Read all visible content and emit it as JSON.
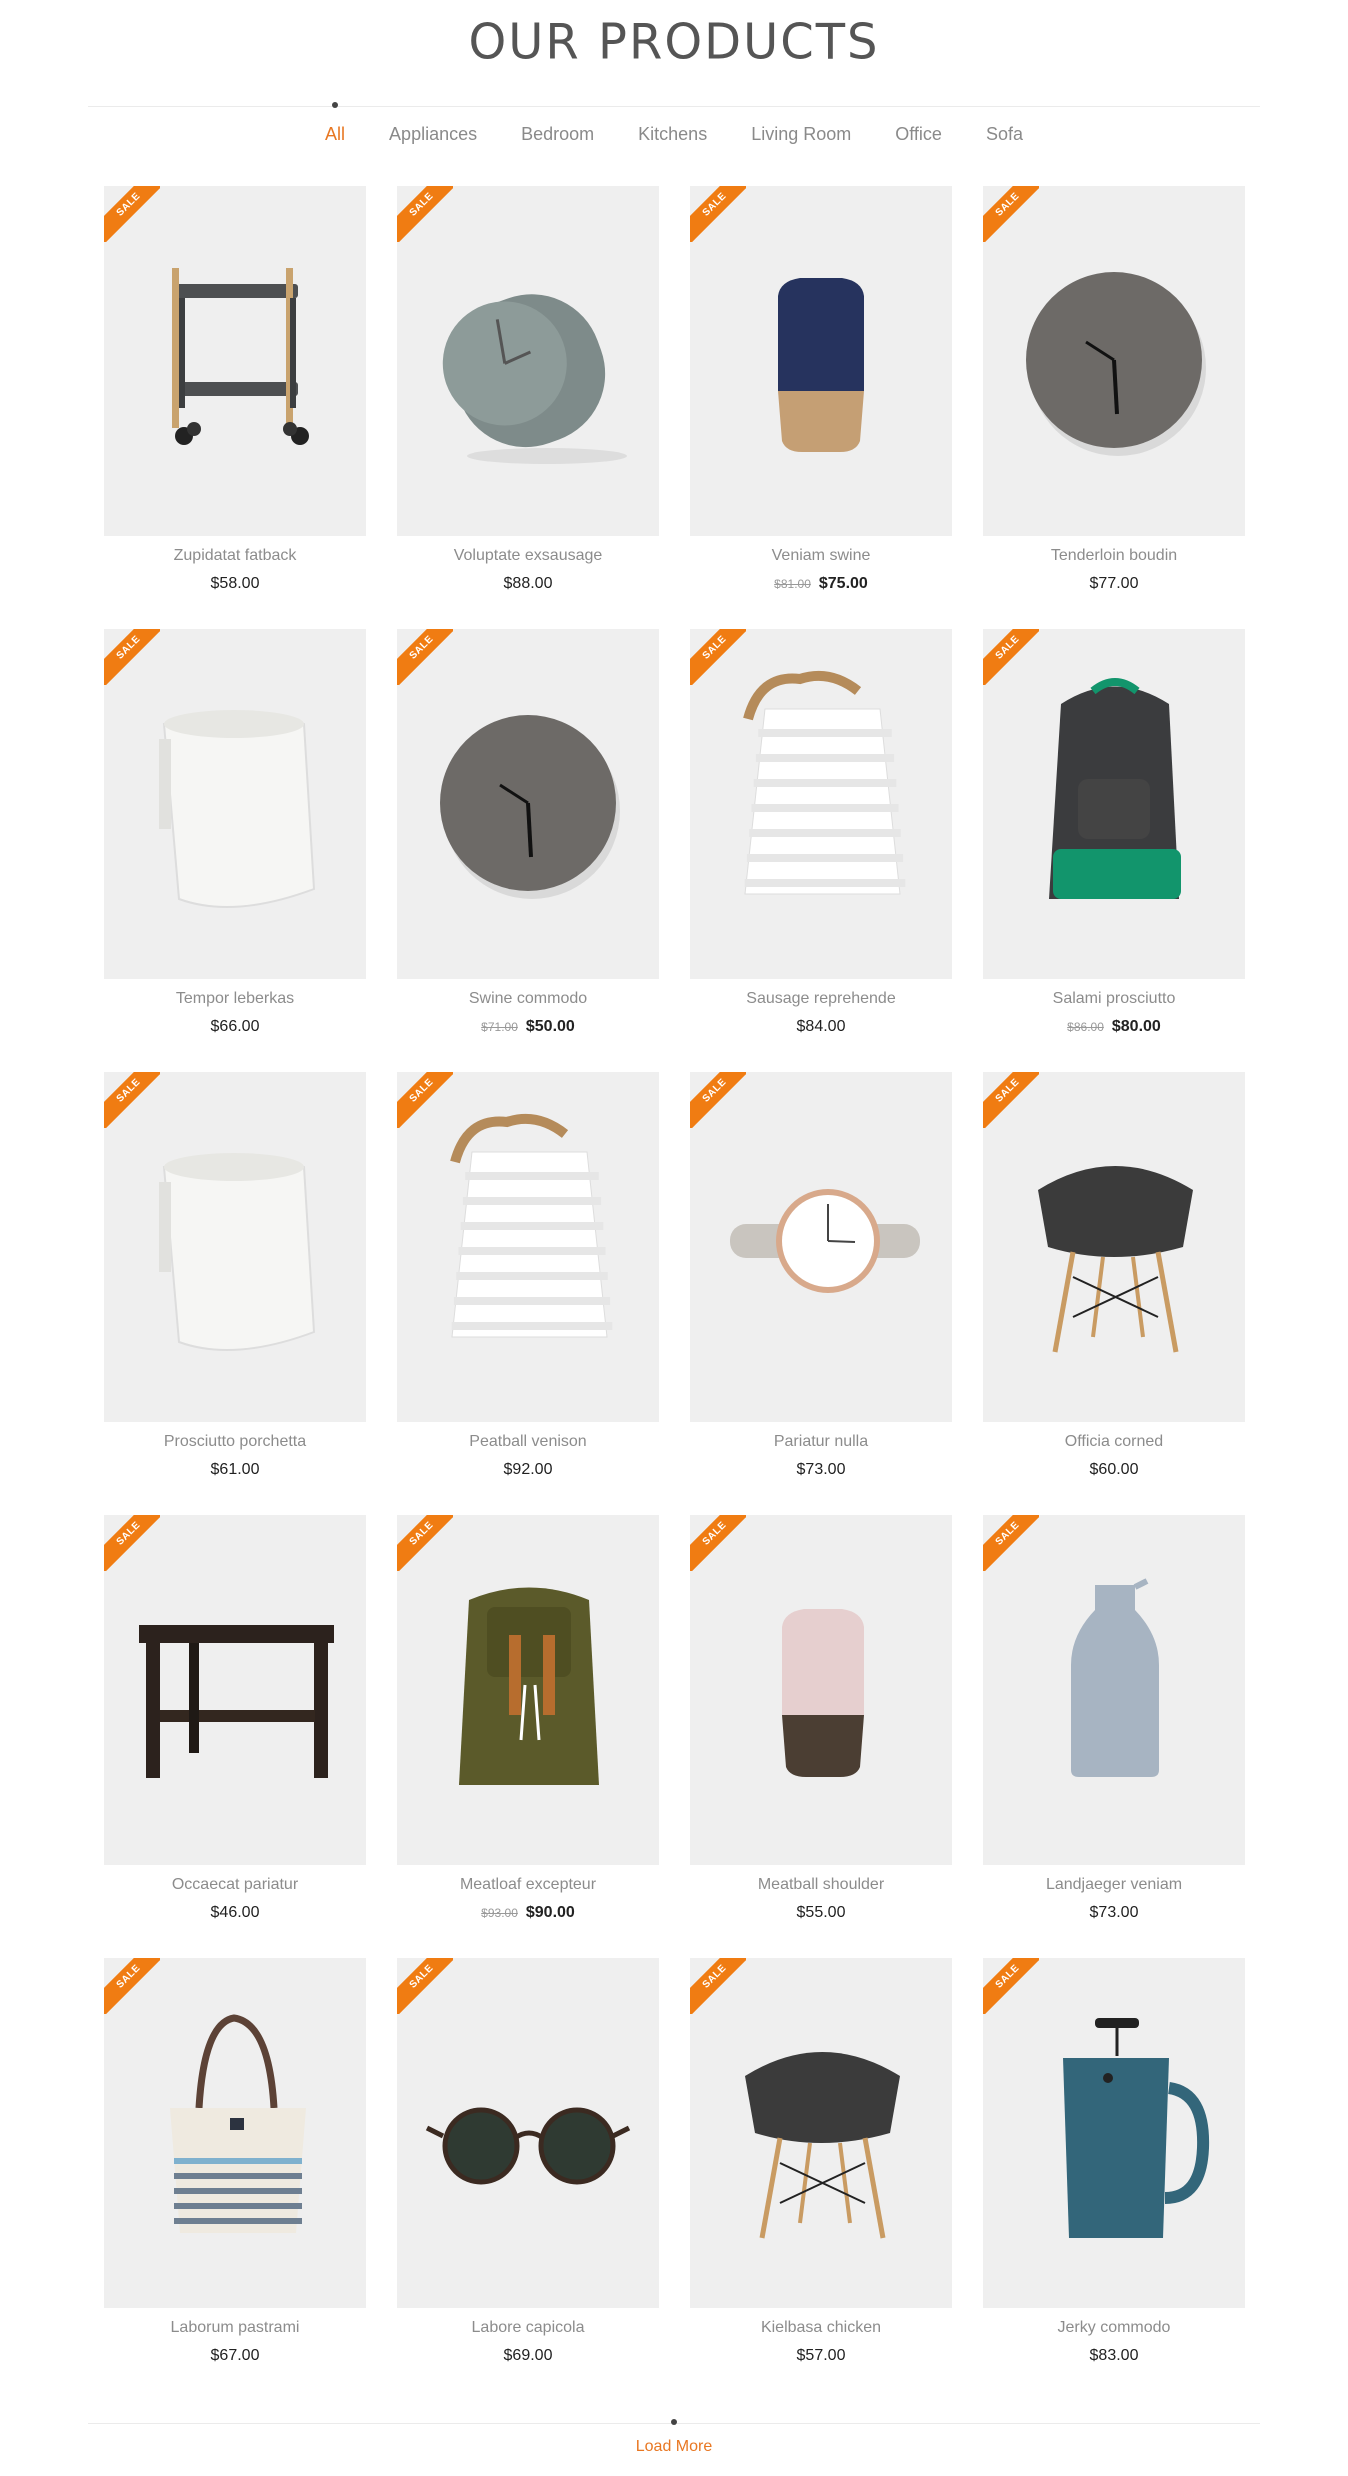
{
  "header": {
    "title": "OUR PRODUCTS"
  },
  "filters": [
    "All",
    "Appliances",
    "Bedroom",
    "Kitchens",
    "Living Room",
    "Office",
    "Sofa"
  ],
  "active_filter": "All",
  "sale_label": "SALE",
  "accent_color": "#f07c12",
  "products": [
    {
      "name": "Zupidatat fatback",
      "price": "$58.00",
      "old_price": "",
      "icon": "bar-cart"
    },
    {
      "name": "Voluptate exsausage",
      "price": "$88.00",
      "old_price": "",
      "icon": "tilted-clock"
    },
    {
      "name": "Veniam swine",
      "price": "$75.00",
      "old_price": "$81.00",
      "icon": "blue-vase"
    },
    {
      "name": "Tenderloin boudin",
      "price": "$77.00",
      "old_price": "",
      "icon": "wall-clock"
    },
    {
      "name": "Tempor leberkas",
      "price": "$66.00",
      "old_price": "",
      "icon": "laundry-basket"
    },
    {
      "name": "Swine commodo",
      "price": "$50.00",
      "old_price": "$71.00",
      "icon": "wall-clock"
    },
    {
      "name": "Sausage reprehende",
      "price": "$84.00",
      "old_price": "",
      "icon": "rope-stool"
    },
    {
      "name": "Salami prosciutto",
      "price": "$80.00",
      "old_price": "$86.00",
      "icon": "gray-backpack"
    },
    {
      "name": "Prosciutto porchetta",
      "price": "$61.00",
      "old_price": "",
      "icon": "laundry-basket"
    },
    {
      "name": "Peatball venison",
      "price": "$92.00",
      "old_price": "",
      "icon": "rope-stool"
    },
    {
      "name": "Pariatur nulla",
      "price": "$73.00",
      "old_price": "",
      "icon": "wristwatch"
    },
    {
      "name": "Officia corned",
      "price": "$60.00",
      "old_price": "",
      "icon": "eames-chair"
    },
    {
      "name": "Occaecat pariatur",
      "price": "$46.00",
      "old_price": "",
      "icon": "side-table"
    },
    {
      "name": "Meatloaf excepteur",
      "price": "$90.00",
      "old_price": "$93.00",
      "icon": "olive-backpack"
    },
    {
      "name": "Meatball shoulder",
      "price": "$55.00",
      "old_price": "",
      "icon": "pink-vase"
    },
    {
      "name": "Landjaeger veniam",
      "price": "$73.00",
      "old_price": "",
      "icon": "bottle"
    },
    {
      "name": "Laborum pastrami",
      "price": "$67.00",
      "old_price": "",
      "icon": "tote-bag"
    },
    {
      "name": "Labore capicola",
      "price": "$69.00",
      "old_price": "",
      "icon": "sunglasses"
    },
    {
      "name": "Kielbasa chicken",
      "price": "$57.00",
      "old_price": "",
      "icon": "eames-chair"
    },
    {
      "name": "Jerky commodo",
      "price": "$83.00",
      "old_price": "",
      "icon": "french-press"
    }
  ],
  "load_more": "Load More"
}
